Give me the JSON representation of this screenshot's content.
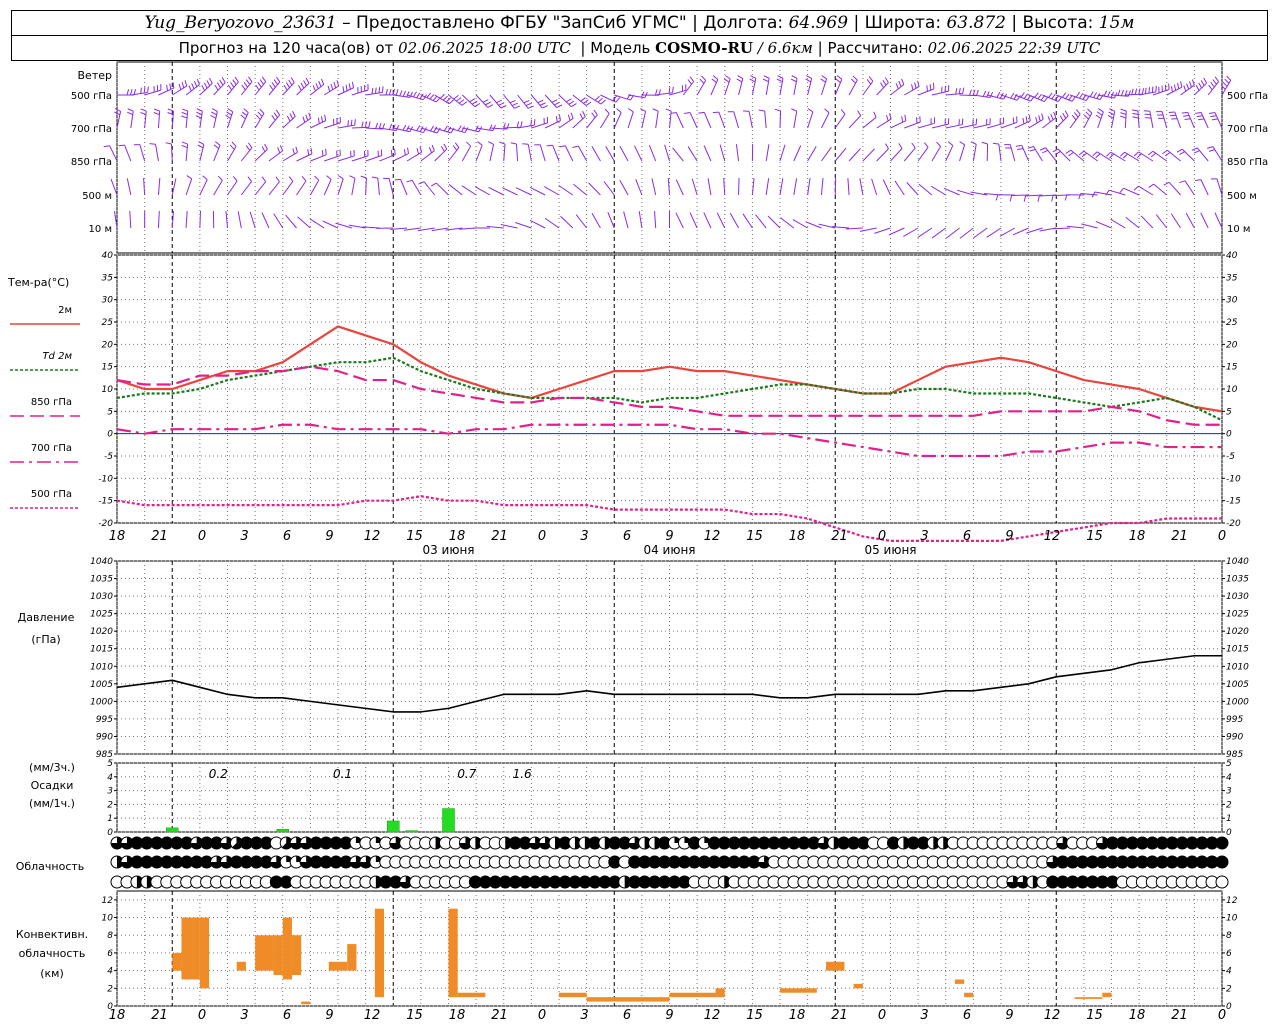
{
  "header": {
    "station": "Yug_Beryozovo_23631",
    "provider": "– Предоставлено ФГБУ \"ЗапСиб УГМС\"",
    "lon_label": "| Долгота:",
    "lon_value": "64.969",
    "lat_label": "| Широта:",
    "lat_value": "63.872",
    "alt_label": "| Высота:",
    "alt_value": "15м",
    "fc_label": "Прогноз на 120 часа(ов) от",
    "fc_date": "02.06.2025 18:00 UTC",
    "model_label": "| Модель",
    "model_name": "COSMO-RU",
    "model_res": "/ 6.6км",
    "calc_label": "| Рассчитано:",
    "calc_date": "02.06.2025 22:39 UTC"
  },
  "chart_data": [
    {
      "type": "wind-barbs",
      "title": "Ветер",
      "levels": [
        "500 гПа",
        "700 гПа",
        "850 гПа",
        "500 м",
        "10 м"
      ],
      "colors": {
        "barb": "#8a2be2"
      }
    },
    {
      "type": "line",
      "title": "Тем-ра(°C)",
      "ylim": [
        -20,
        40
      ],
      "yticks": [
        -20,
        -15,
        -10,
        -5,
        0,
        5,
        10,
        15,
        20,
        25,
        30,
        35,
        40
      ],
      "x": [
        0,
        3,
        6,
        9,
        12,
        15,
        18,
        21,
        24,
        27,
        30,
        33,
        36,
        39,
        42,
        45,
        48,
        51,
        54,
        57,
        60,
        63,
        66,
        69,
        72,
        75,
        78,
        81,
        84,
        87,
        90,
        93,
        96,
        99,
        102,
        105,
        108,
        111,
        114,
        117,
        120
      ],
      "series": [
        {
          "name": "2м",
          "color": "#e8453c",
          "style": "solid",
          "values": [
            12,
            10,
            10,
            12,
            14,
            14,
            16,
            20,
            24,
            22,
            20,
            16,
            13,
            11,
            9,
            8,
            10,
            12,
            14,
            14,
            15,
            14,
            14,
            13,
            12,
            11,
            10,
            9,
            9,
            12,
            15,
            16,
            17,
            16,
            14,
            12,
            11,
            10,
            8,
            6,
            5
          ]
        },
        {
          "name": "Td 2м",
          "color": "#1a7a1a",
          "style": "dotted",
          "values": [
            8,
            9,
            9,
            10,
            12,
            13,
            14,
            15,
            16,
            16,
            17,
            14,
            12,
            10,
            9,
            8,
            8,
            8,
            8,
            7,
            8,
            8,
            9,
            10,
            11,
            11,
            10,
            9,
            9,
            10,
            10,
            9,
            9,
            9,
            8,
            7,
            6,
            7,
            8,
            6,
            3
          ]
        },
        {
          "name": "850 гПа",
          "color": "#e0208c",
          "style": "dash",
          "values": [
            12,
            11,
            11,
            13,
            13,
            14,
            14,
            15,
            14,
            12,
            12,
            10,
            9,
            8,
            7,
            7,
            8,
            8,
            7,
            6,
            6,
            5,
            4,
            4,
            4,
            4,
            4,
            4,
            4,
            4,
            4,
            4,
            5,
            5,
            5,
            5,
            6,
            5,
            3,
            2,
            2
          ]
        },
        {
          "name": "700 гПа",
          "color": "#e0208c",
          "style": "dashdot",
          "values": [
            1,
            0,
            1,
            1,
            1,
            1,
            2,
            2,
            1,
            1,
            1,
            1,
            0,
            1,
            1,
            2,
            2,
            2,
            2,
            2,
            2,
            1,
            1,
            0,
            0,
            -1,
            -2,
            -3,
            -4,
            -5,
            -5,
            -5,
            -5,
            -4,
            -4,
            -3,
            -2,
            -2,
            -3,
            -3,
            -3
          ]
        },
        {
          "name": "500 гПа",
          "color": "#e0208c",
          "style": "dotted",
          "values": [
            -15,
            -16,
            -16,
            -16,
            -16,
            -16,
            -16,
            -16,
            -16,
            -15,
            -15,
            -14,
            -15,
            -15,
            -16,
            -16,
            -16,
            -16,
            -17,
            -17,
            -17,
            -17,
            -17,
            -18,
            -18,
            -19,
            -21,
            -23,
            -24,
            -24,
            -24,
            -24,
            -24,
            -23,
            -22,
            -21,
            -20,
            -20,
            -19,
            -19,
            -19
          ]
        }
      ],
      "date_labels": [
        "03 июня",
        "04 июня",
        "05 июня"
      ],
      "hour_ticks": [
        "18",
        "21",
        "0",
        "3",
        "6",
        "9",
        "12",
        "15",
        "18",
        "21",
        "0",
        "3",
        "6",
        "9",
        "12",
        "15",
        "18",
        "21",
        "0",
        "3",
        "6",
        "9",
        "12",
        "15",
        "18",
        "21",
        "0"
      ]
    },
    {
      "type": "line",
      "title": "Давление",
      "ylabel": "(гПа)",
      "ylim": [
        985,
        1040
      ],
      "yticks": [
        985,
        990,
        995,
        1000,
        1005,
        1010,
        1015,
        1020,
        1025,
        1030,
        1035,
        1040
      ],
      "x": [
        0,
        3,
        6,
        9,
        12,
        15,
        18,
        21,
        24,
        27,
        30,
        33,
        36,
        39,
        42,
        45,
        48,
        51,
        54,
        57,
        60,
        63,
        66,
        69,
        72,
        75,
        78,
        81,
        84,
        87,
        90,
        93,
        96,
        99,
        102,
        105,
        108,
        111,
        114,
        117,
        120
      ],
      "series": [
        {
          "name": "",
          "color": "#000000",
          "values": [
            1004,
            1005,
            1006,
            1004,
            1002,
            1001,
            1001,
            1000,
            999,
            998,
            997,
            997,
            998,
            1000,
            1002,
            1002,
            1002,
            1003,
            1002,
            1002,
            1002,
            1002,
            1002,
            1002,
            1001,
            1001,
            1002,
            1002,
            1002,
            1002,
            1003,
            1003,
            1004,
            1005,
            1007,
            1008,
            1009,
            1011,
            1012,
            1013,
            1013
          ]
        }
      ]
    },
    {
      "type": "bar",
      "title": "Осадки",
      "ylabel": "(мм/3ч.)",
      "ylabel2": "(мм/1ч.)",
      "ylim": [
        0,
        5
      ],
      "yticks": [
        0,
        1,
        2,
        3,
        4,
        5
      ],
      "bars": [
        {
          "x": 6,
          "value": 0.3
        },
        {
          "x": 18,
          "value": 0.2
        },
        {
          "x": 30,
          "value": 0.8
        },
        {
          "x": 32,
          "value": 0.1
        },
        {
          "x": 36,
          "value": 1.7
        }
      ],
      "totals": [
        {
          "x": 7,
          "label": "0.2"
        },
        {
          "x": 16,
          "label": "0.1"
        },
        {
          "x": 25,
          "label": "0.7"
        },
        {
          "x": 29,
          "label": "1.6"
        }
      ],
      "colors": {
        "bar": "#22dd22"
      }
    },
    {
      "type": "table",
      "title": "Облачность",
      "note": "3 rows (upper / middle / lower cloud), values in octas 0–8 per hour",
      "rows": [
        [
          6,
          6,
          8,
          8,
          8,
          8,
          8,
          8,
          6,
          8,
          8,
          6,
          5,
          8,
          8,
          8,
          0,
          5,
          6,
          6,
          8,
          8,
          8,
          8,
          2,
          0,
          2,
          0,
          6,
          0,
          0,
          0,
          4,
          0,
          0,
          6,
          4,
          0,
          0,
          4,
          8,
          8,
          6,
          6,
          4,
          8,
          4,
          4,
          8,
          4,
          8,
          8,
          6,
          4,
          4,
          8,
          2,
          2,
          8,
          2,
          8,
          8,
          8,
          8,
          8,
          8,
          8,
          8,
          8,
          8,
          8,
          6,
          4,
          8,
          8,
          8,
          0,
          0,
          8,
          4,
          8,
          8,
          4,
          4,
          0,
          0,
          0,
          0,
          0,
          0,
          0,
          0,
          0,
          0,
          0,
          6,
          0,
          0,
          0,
          6,
          8,
          8,
          8,
          8,
          8,
          8,
          8,
          8,
          8,
          8,
          8,
          8
        ],
        [
          4,
          6,
          8,
          8,
          8,
          8,
          8,
          8,
          8,
          8,
          6,
          6,
          8,
          8,
          8,
          8,
          6,
          2,
          2,
          6,
          8,
          8,
          8,
          8,
          6,
          6,
          2,
          0,
          0,
          0,
          0,
          0,
          0,
          0,
          0,
          0,
          0,
          0,
          0,
          0,
          0,
          0,
          0,
          0,
          0,
          0,
          0,
          0,
          0,
          0,
          8,
          0,
          8,
          8,
          8,
          8,
          8,
          8,
          8,
          8,
          8,
          8,
          8,
          8,
          8,
          6,
          0,
          0,
          0,
          0,
          0,
          0,
          0,
          0,
          0,
          0,
          0,
          0,
          0,
          0,
          0,
          0,
          0,
          0,
          0,
          0,
          0,
          0,
          0,
          0,
          0,
          0,
          0,
          0,
          6,
          8,
          8,
          8,
          8,
          8,
          8,
          8,
          8,
          8,
          8,
          8,
          8,
          8,
          8,
          8,
          8,
          8
        ],
        [
          0,
          0,
          4,
          4,
          0,
          0,
          0,
          0,
          0,
          0,
          0,
          0,
          0,
          0,
          0,
          0,
          8,
          8,
          0,
          0,
          0,
          0,
          0,
          0,
          0,
          0,
          4,
          8,
          8,
          6,
          0,
          0,
          0,
          0,
          0,
          0,
          8,
          8,
          8,
          8,
          8,
          8,
          8,
          8,
          8,
          8,
          8,
          8,
          8,
          8,
          8,
          4,
          8,
          8,
          8,
          8,
          8,
          8,
          0,
          0,
          0,
          4,
          0,
          0,
          0,
          0,
          0,
          0,
          0,
          0,
          0,
          0,
          0,
          0,
          0,
          0,
          0,
          0,
          0,
          0,
          0,
          0,
          0,
          0,
          0,
          0,
          0,
          0,
          0,
          0,
          6,
          6,
          4,
          0,
          8,
          8,
          8,
          8,
          8,
          8,
          8,
          0,
          0,
          0,
          0,
          0,
          0,
          0,
          0,
          0,
          0,
          0
        ]
      ]
    },
    {
      "type": "bar",
      "title": "Конвективн. облачность",
      "ylabel": "(км)",
      "ylim": [
        0,
        13
      ],
      "yticks": [
        0,
        2,
        4,
        6,
        8,
        10,
        12
      ],
      "ranges": [
        {
          "x0": 6,
          "x1": 7,
          "base": 4,
          "top": 6
        },
        {
          "x0": 7,
          "x1": 9,
          "base": 3,
          "top": 10
        },
        {
          "x0": 9,
          "x1": 10,
          "base": 2,
          "top": 10
        },
        {
          "x0": 13,
          "x1": 14,
          "base": 4,
          "top": 5
        },
        {
          "x0": 15,
          "x1": 17,
          "base": 4,
          "top": 8
        },
        {
          "x0": 17,
          "x1": 18,
          "base": 3.5,
          "top": 8
        },
        {
          "x0": 18,
          "x1": 19,
          "base": 3,
          "top": 10
        },
        {
          "x0": 19,
          "x1": 20,
          "base": 3.5,
          "top": 8
        },
        {
          "x0": 20,
          "x1": 21,
          "base": 0.2,
          "top": 0.5
        },
        {
          "x0": 23,
          "x1": 25,
          "base": 4,
          "top": 5
        },
        {
          "x0": 25,
          "x1": 26,
          "base": 4,
          "top": 7
        },
        {
          "x0": 28,
          "x1": 29,
          "base": 1,
          "top": 11
        },
        {
          "x0": 36,
          "x1": 37,
          "base": 1,
          "top": 11
        },
        {
          "x0": 37,
          "x1": 40,
          "base": 1,
          "top": 1.5
        },
        {
          "x0": 48,
          "x1": 51,
          "base": 1,
          "top": 1.5
        },
        {
          "x0": 51,
          "x1": 60,
          "base": 0.5,
          "top": 1
        },
        {
          "x0": 60,
          "x1": 65,
          "base": 1,
          "top": 1.5
        },
        {
          "x0": 65,
          "x1": 66,
          "base": 1,
          "top": 2
        },
        {
          "x0": 72,
          "x1": 76,
          "base": 1.5,
          "top": 2
        },
        {
          "x0": 77,
          "x1": 79,
          "base": 4,
          "top": 5
        },
        {
          "x0": 80,
          "x1": 81,
          "base": 2,
          "top": 2.5
        },
        {
          "x0": 91,
          "x1": 92,
          "base": 2.5,
          "top": 3
        },
        {
          "x0": 92,
          "x1": 93,
          "base": 1,
          "top": 1.5
        },
        {
          "x0": 104,
          "x1": 107,
          "base": 0.8,
          "top": 1
        },
        {
          "x0": 107,
          "x1": 108,
          "base": 1,
          "top": 1.5
        }
      ],
      "colors": {
        "bar": "#f08c28"
      }
    }
  ]
}
